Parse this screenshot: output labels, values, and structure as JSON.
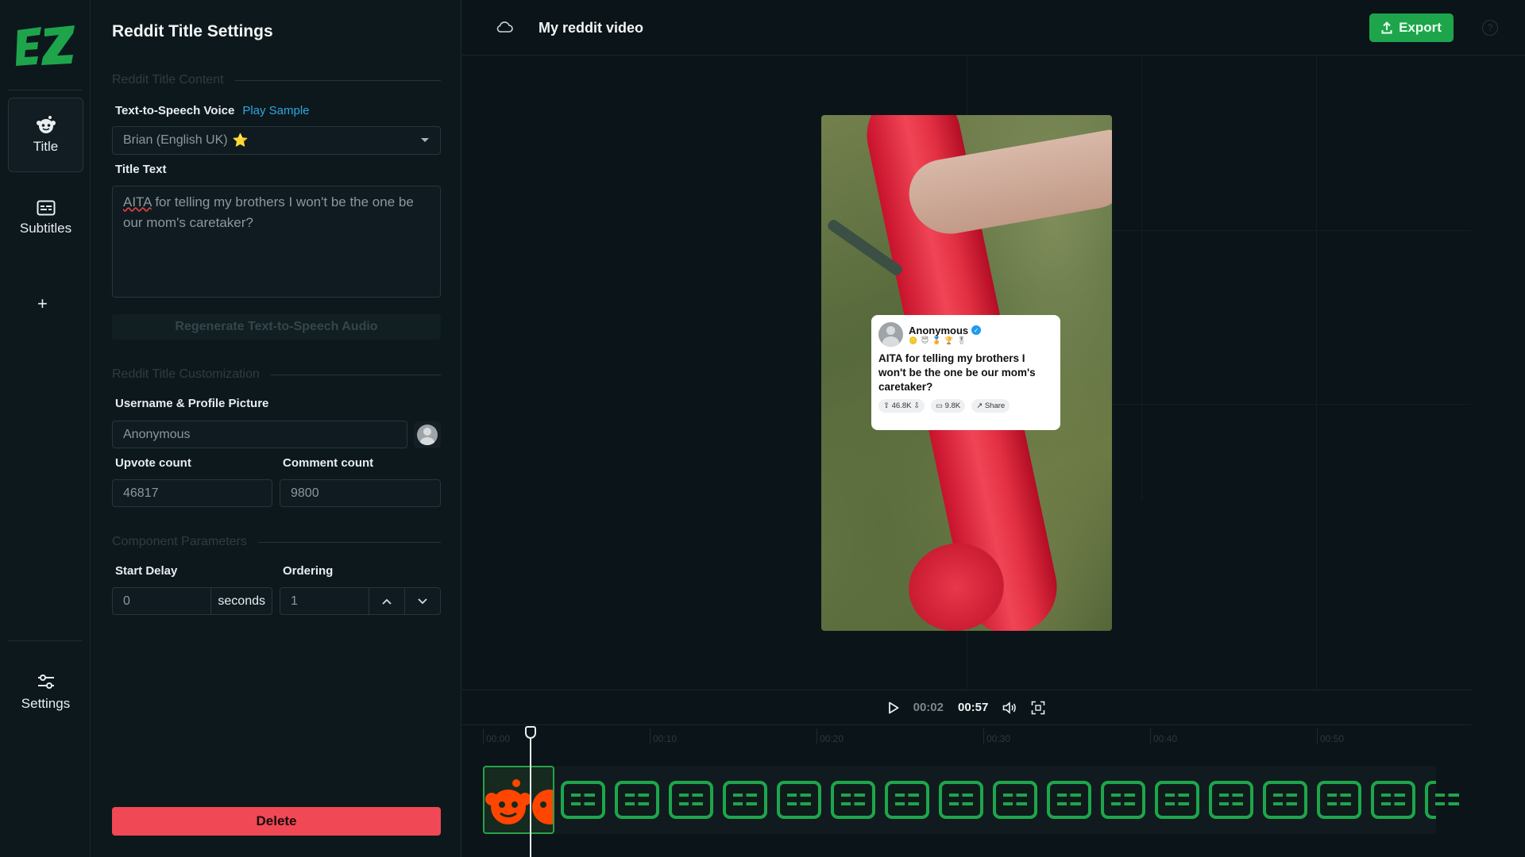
{
  "rail": {
    "items": [
      {
        "label": "Title",
        "icon": "reddit-icon"
      },
      {
        "label": "Subtitles",
        "icon": "subtitles-icon"
      }
    ],
    "add_label": "+",
    "settings_label": "Settings"
  },
  "panel": {
    "title": "Reddit Title Settings",
    "section_content": "Reddit Title Content",
    "tts_label": "Text-to-Speech Voice",
    "play_sample": "Play Sample",
    "voice_value": "Brian (English UK)",
    "voice_star": "⭐",
    "title_text_label": "Title Text",
    "title_text_prefix": "AITA",
    "title_text_rest": " for telling my brothers I won't be the one be our mom's caretaker?",
    "regenerate_label": "Regenerate Text-to-Speech Audio",
    "section_customization": "Reddit Title Customization",
    "username_label": "Username & Profile Picture",
    "username_value": "Anonymous",
    "upvote_label": "Upvote count",
    "upvote_value": "46817",
    "comment_label": "Comment count",
    "comment_value": "9800",
    "section_params": "Component Parameters",
    "start_delay_label": "Start Delay",
    "start_delay_value": "0",
    "start_delay_unit": "seconds",
    "ordering_label": "Ordering",
    "ordering_value": "1",
    "delete_label": "Delete"
  },
  "topbar": {
    "project_title": "My reddit video",
    "export_label": "Export",
    "help_label": "?"
  },
  "reddit_card": {
    "username": "Anonymous",
    "awards": "🪙 😇 🏅 🏆 🎖",
    "title": "AITA for telling my brothers I won't be the one be our mom's caretaker?",
    "upvotes": "46.8K",
    "comments": "9.8K",
    "share": "Share"
  },
  "playback": {
    "current_time": "00:02",
    "total_time": "00:57"
  },
  "timeline": {
    "ruler": [
      "00:00",
      "00:10",
      "00:20",
      "00:30",
      "00:40",
      "00:50"
    ]
  },
  "colors": {
    "accent_green": "#1ea54c",
    "delete_red": "#f04854",
    "link_blue": "#2ea7e0",
    "reddit_orange": "#ff4500"
  }
}
